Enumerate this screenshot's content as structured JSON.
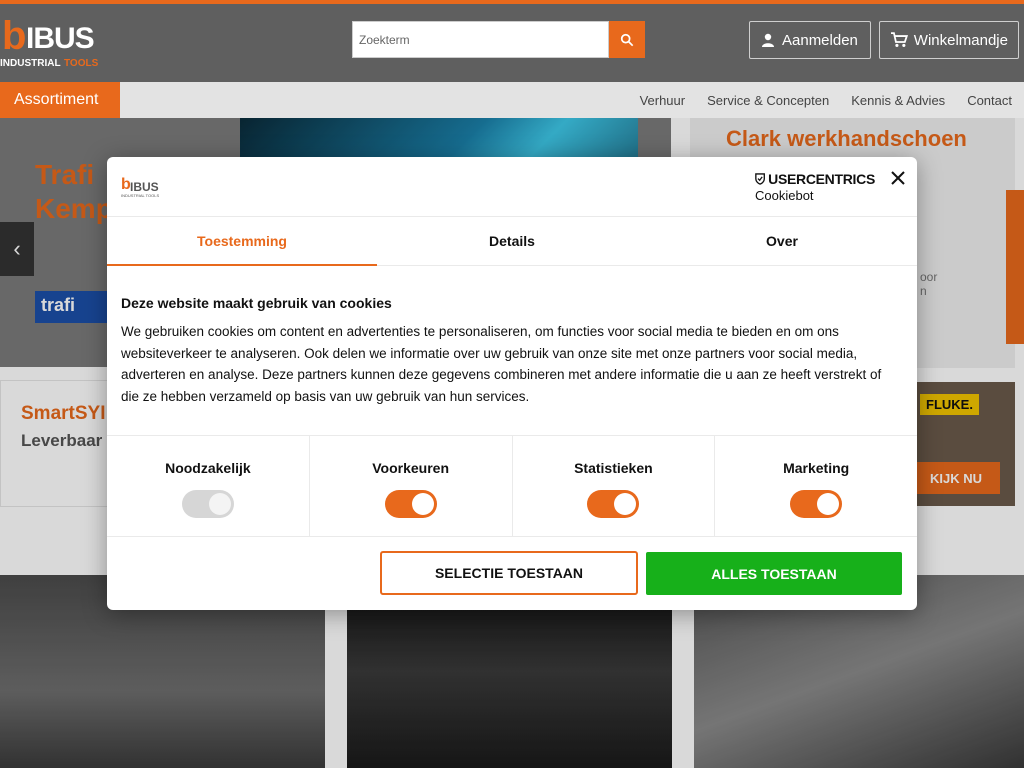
{
  "header": {
    "logo": {
      "letter": "b",
      "word": "IBUS",
      "sub_left": "INDUSTRIAL",
      "sub_right": "TOOLS"
    },
    "search": {
      "placeholder": "Zoekterm",
      "icon": "search-icon"
    },
    "login_label": "Aanmelden",
    "cart_label": "Winkelmandje"
  },
  "nav": {
    "assortiment": "Assortiment",
    "links": [
      "Verhuur",
      "Service & Concepten",
      "Kennis & Advies",
      "Contact"
    ]
  },
  "background": {
    "hero_title_line1": "Trafi",
    "hero_title_line2": "Kemp",
    "hero_brand": "trafi",
    "promo_right_title": "Clark werkhandschoen",
    "promo_right_text_1": "oor",
    "promo_right_text_2": "n",
    "card2_title": "SmartSYI",
    "card2_sub": "Leverbaar",
    "card3_brand": "FLUKE.",
    "card3_button": "KIJK NU"
  },
  "cookie_dialog": {
    "logo": {
      "letter": "b",
      "word": "IBUS",
      "sub": "INDUSTRIAL TOOLS"
    },
    "usercentrics_top": "USERCENTRICS",
    "usercentrics_bottom": "Cookiebot",
    "tabs": [
      "Toestemming",
      "Details",
      "Over"
    ],
    "active_tab": "Toestemming",
    "heading": "Deze website maakt gebruik van cookies",
    "body": "We gebruiken cookies om content en advertenties te personaliseren, om functies voor social media te bieden en om ons websiteverkeer te analyseren. Ook delen we informatie over uw gebruik van onze site met onze partners voor social media, adverteren en analyse. Deze partners kunnen deze gegevens combineren met andere informatie die u aan ze heeft verstrekt of die ze hebben verzameld op basis van uw gebruik van hun services.",
    "categories": [
      {
        "label": "Noodzakelijk",
        "enabled": true,
        "disabled": true
      },
      {
        "label": "Voorkeuren",
        "enabled": true,
        "disabled": false
      },
      {
        "label": "Statistieken",
        "enabled": true,
        "disabled": false
      },
      {
        "label": "Marketing",
        "enabled": true,
        "disabled": false
      }
    ],
    "btn_selection": "SELECTIE TOESTAAN",
    "btn_all": "ALLES TOESTAAN"
  },
  "colors": {
    "brand_orange": "#e8691c",
    "header_gray": "#5f5f5f",
    "accept_green": "#17b01a"
  }
}
